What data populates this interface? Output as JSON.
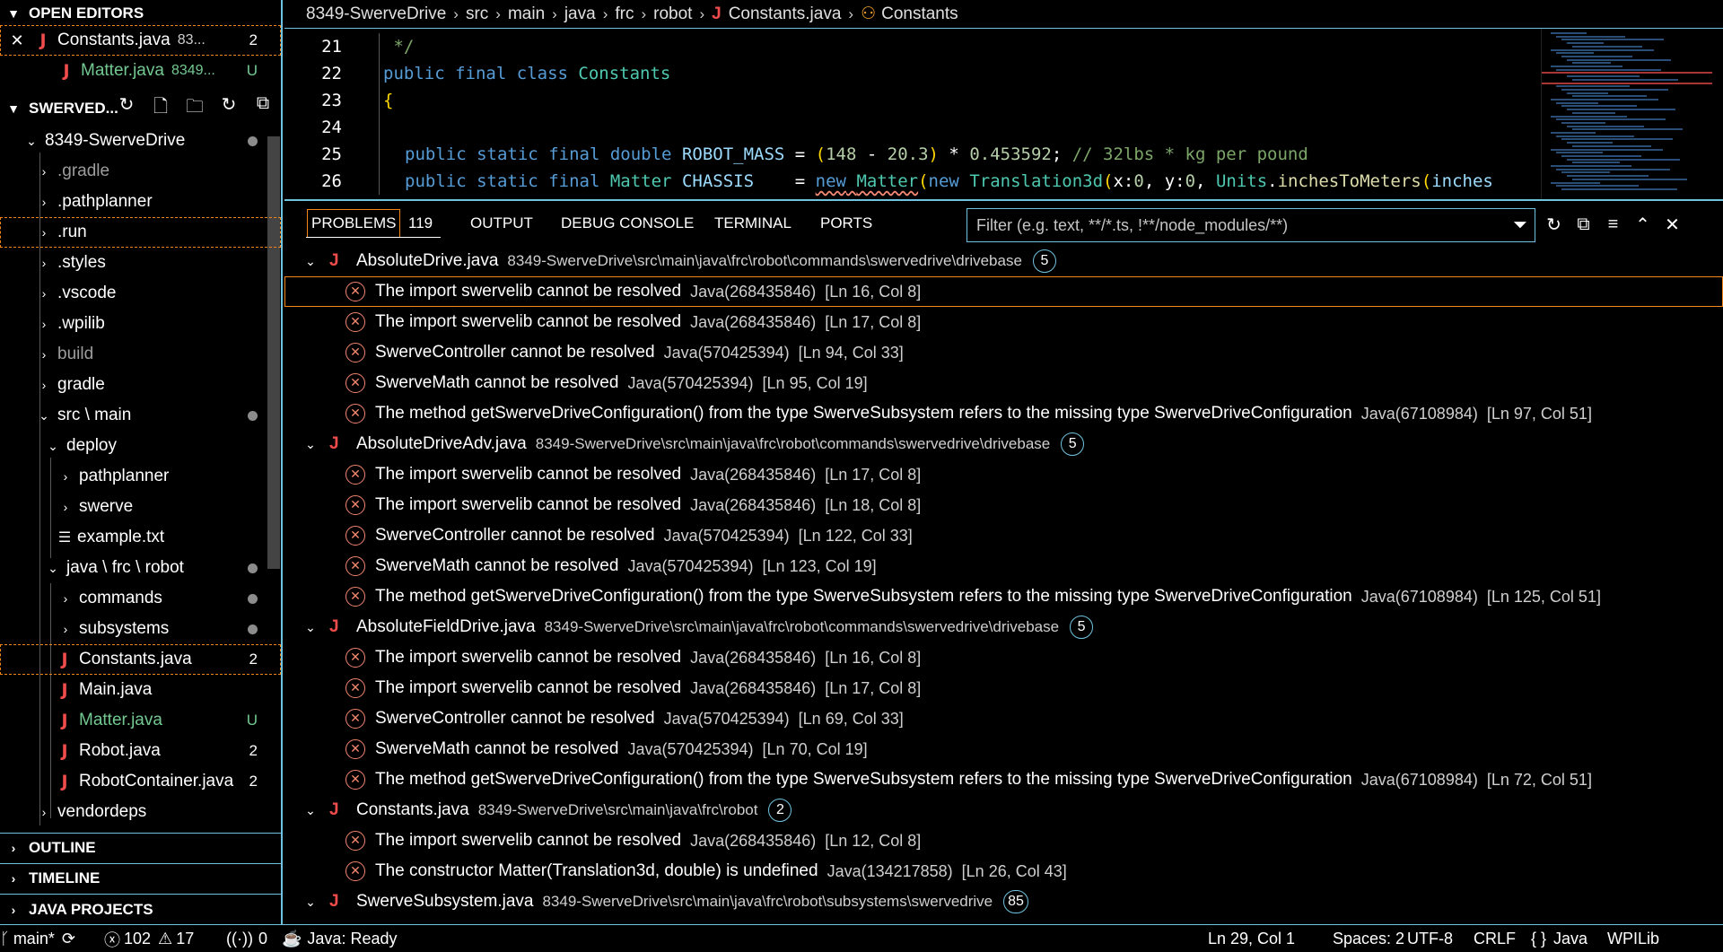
{
  "sidebar": {
    "open_editors": {
      "title": "OPEN EDITORS",
      "items": [
        {
          "close": "✕",
          "name": "Constants.java",
          "desc": "83...",
          "badge": "2"
        },
        {
          "name": "Matter.java",
          "desc": "8349...",
          "badge": "U"
        }
      ]
    },
    "explorer": {
      "title": "SWERVED...",
      "root": "8349-SwerveDrive",
      "items": [
        {
          "label": ".gradle"
        },
        {
          "label": ".pathplanner"
        },
        {
          "label": ".run"
        },
        {
          "label": ".styles"
        },
        {
          "label": ".vscode"
        },
        {
          "label": ".wpilib"
        },
        {
          "label": "build"
        },
        {
          "label": "gradle"
        },
        {
          "label": "src \\ main"
        },
        {
          "label": "deploy"
        },
        {
          "label": "pathplanner"
        },
        {
          "label": "swerve"
        },
        {
          "label": "example.txt"
        },
        {
          "label": "java \\ frc \\ robot"
        },
        {
          "label": "commands"
        },
        {
          "label": "subsystems"
        },
        {
          "label": "Constants.java",
          "badge": "2"
        },
        {
          "label": "Main.java"
        },
        {
          "label": "Matter.java",
          "badge": "U"
        },
        {
          "label": "Robot.java",
          "badge": "2"
        },
        {
          "label": "RobotContainer.java",
          "badge": "2"
        },
        {
          "label": "vendordeps"
        }
      ]
    },
    "outline": "OUTLINE",
    "timeline": "TIMELINE",
    "java_projects": "JAVA PROJECTS"
  },
  "editor": {
    "breadcrumb": [
      "8349-SwerveDrive",
      "src",
      "main",
      "java",
      "frc",
      "robot",
      "Constants.java",
      "Constants"
    ],
    "lines": [
      {
        "n": "21",
        "text": " */"
      },
      {
        "n": "22",
        "text": "public final class Constants"
      },
      {
        "n": "23",
        "text": "{"
      },
      {
        "n": "24",
        "text": ""
      },
      {
        "n": "25",
        "text": "public static final double ROBOT_MASS = (148 - 20.3) * 0.453592; // 32lbs * kg per pound"
      },
      {
        "n": "26",
        "text": "public static final Matter CHASSIS    = new Matter(new Translation3d(x:0, y:0, Units.inchesToMeters(inches"
      }
    ]
  },
  "panel": {
    "tabs": {
      "problems": "PROBLEMS",
      "problems_count": "119",
      "output": "OUTPUT",
      "debug_console": "DEBUG CONSOLE",
      "terminal": "TERMINAL",
      "ports": "PORTS"
    },
    "filter_placeholder": "Filter (e.g. text, **/*.ts, !**/node_modules/**)",
    "groups": [
      {
        "file": "AbsoluteDrive.java",
        "path": "8349-SwerveDrive\\src\\main\\java\\frc\\robot\\commands\\swervedrive\\drivebase",
        "count": "5",
        "problems": [
          {
            "msg": "The import swervelib cannot be resolved",
            "src": "Java(268435846)",
            "loc": "[Ln 16, Col 8]"
          },
          {
            "msg": "The import swervelib cannot be resolved",
            "src": "Java(268435846)",
            "loc": "[Ln 17, Col 8]"
          },
          {
            "msg": "SwerveController cannot be resolved",
            "src": "Java(570425394)",
            "loc": "[Ln 94, Col 33]"
          },
          {
            "msg": "SwerveMath cannot be resolved",
            "src": "Java(570425394)",
            "loc": "[Ln 95, Col 19]"
          },
          {
            "msg": "The method getSwerveDriveConfiguration() from the type SwerveSubsystem refers to the missing type SwerveDriveConfiguration",
            "src": "Java(67108984)",
            "loc": "[Ln 97, Col 51]"
          }
        ]
      },
      {
        "file": "AbsoluteDriveAdv.java",
        "path": "8349-SwerveDrive\\src\\main\\java\\frc\\robot\\commands\\swervedrive\\drivebase",
        "count": "5",
        "problems": [
          {
            "msg": "The import swervelib cannot be resolved",
            "src": "Java(268435846)",
            "loc": "[Ln 17, Col 8]"
          },
          {
            "msg": "The import swervelib cannot be resolved",
            "src": "Java(268435846)",
            "loc": "[Ln 18, Col 8]"
          },
          {
            "msg": "SwerveController cannot be resolved",
            "src": "Java(570425394)",
            "loc": "[Ln 122, Col 33]"
          },
          {
            "msg": "SwerveMath cannot be resolved",
            "src": "Java(570425394)",
            "loc": "[Ln 123, Col 19]"
          },
          {
            "msg": "The method getSwerveDriveConfiguration() from the type SwerveSubsystem refers to the missing type SwerveDriveConfiguration",
            "src": "Java(67108984)",
            "loc": "[Ln 125, Col 51]"
          }
        ]
      },
      {
        "file": "AbsoluteFieldDrive.java",
        "path": "8349-SwerveDrive\\src\\main\\java\\frc\\robot\\commands\\swervedrive\\drivebase",
        "count": "5",
        "problems": [
          {
            "msg": "The import swervelib cannot be resolved",
            "src": "Java(268435846)",
            "loc": "[Ln 16, Col 8]"
          },
          {
            "msg": "The import swervelib cannot be resolved",
            "src": "Java(268435846)",
            "loc": "[Ln 17, Col 8]"
          },
          {
            "msg": "SwerveController cannot be resolved",
            "src": "Java(570425394)",
            "loc": "[Ln 69, Col 33]"
          },
          {
            "msg": "SwerveMath cannot be resolved",
            "src": "Java(570425394)",
            "loc": "[Ln 70, Col 19]"
          },
          {
            "msg": "The method getSwerveDriveConfiguration() from the type SwerveSubsystem refers to the missing type SwerveDriveConfiguration",
            "src": "Java(67108984)",
            "loc": "[Ln 72, Col 51]"
          }
        ]
      },
      {
        "file": "Constants.java",
        "path": "8349-SwerveDrive\\src\\main\\java\\frc\\robot",
        "count": "2",
        "problems": [
          {
            "msg": "The import swervelib cannot be resolved",
            "src": "Java(268435846)",
            "loc": "[Ln 12, Col 8]"
          },
          {
            "msg": "The constructor Matter(Translation3d, double) is undefined",
            "src": "Java(134217858)",
            "loc": "[Ln 26, Col 43]"
          }
        ]
      },
      {
        "file": "SwerveSubsystem.java",
        "path": "8349-SwerveDrive\\src\\main\\java\\frc\\robot\\subsystems\\swervedrive",
        "count": "85",
        "problems": []
      }
    ]
  },
  "statusbar": {
    "branch": "main*",
    "errors": "102",
    "warnings": "17",
    "ports": "0",
    "java_status": "Java: Ready",
    "position": "Ln 29, Col 1",
    "spaces": "Spaces: 2",
    "encoding": "UTF-8",
    "eol": "CRLF",
    "language": "Java",
    "extension": "WPILib"
  },
  "colors": {
    "border": "#6fc3df",
    "focus": "#f38518",
    "error": "#f48771",
    "java_icon": "#f14c4c",
    "untracked": "#73c991"
  }
}
